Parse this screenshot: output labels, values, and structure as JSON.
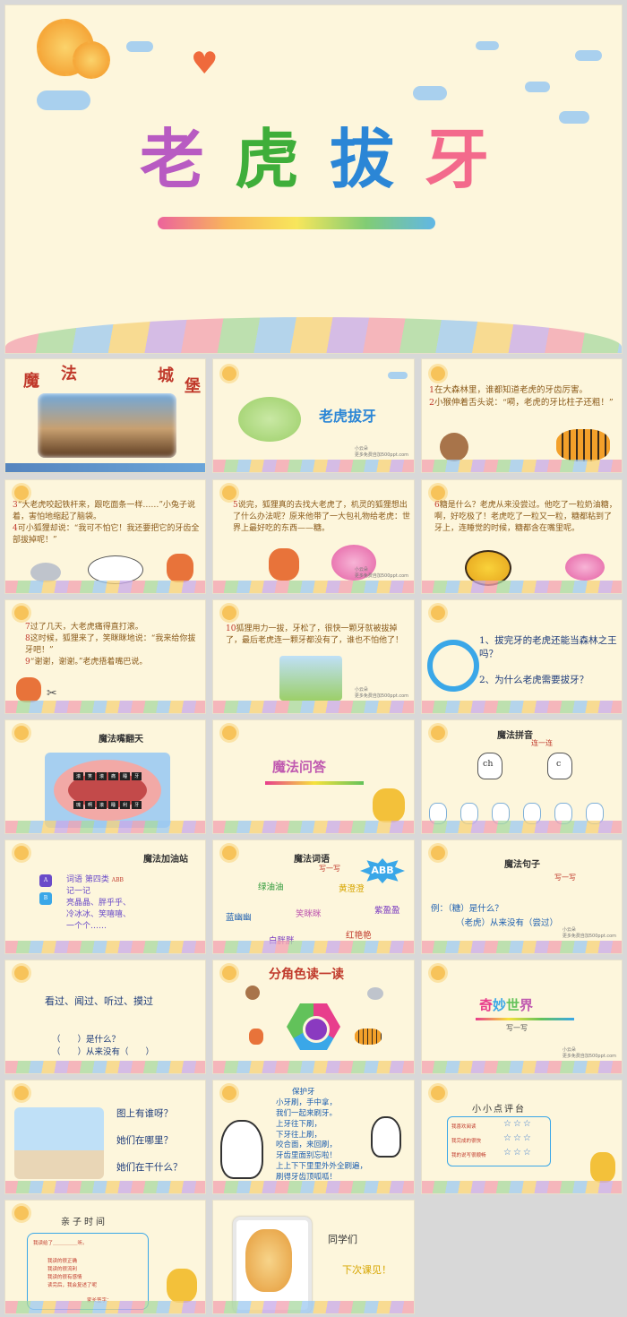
{
  "cover": {
    "c1": "老",
    "c2": "虎",
    "c3": "拔",
    "c4": "牙"
  },
  "s1": {
    "w1": "魔",
    "w2": "法",
    "w3": "城",
    "w4": "堡"
  },
  "s2": {
    "title": "老虎拔牙",
    "foot1": "小云朵",
    "foot2": "更多免费自加500ppt.com"
  },
  "s3": {
    "n1": "1",
    "p1": "在大森林里，谁都知道老虎的牙齿厉害。",
    "n2": "2",
    "p2": "小猴伸着舌头说：“嗬，老虎的牙比柱子还粗！”"
  },
  "s4": {
    "n1": "3",
    "p1": "“大老虎咬起铁杆来，跟吃面条一样……”小兔子说着，害怕地缩起了脑袋。",
    "n2": "4",
    "p2": "可小狐狸却说：“我可不怕它！我还要把它的牙齿全部拔掉呢！”"
  },
  "s5": {
    "n1": "5",
    "p1": "说完，狐狸真的去找大老虎了，机灵的狐狸想出了什么办法呢？原来他带了一大包礼物给老虎：世界上最好吃的东西——糖。",
    "foot1": "小云朵",
    "foot2": "更多免费自加500ppt.com"
  },
  "s6": {
    "n1": "6",
    "p1": "糖是什么？老虎从来没尝过。他吃了一粒奶油糖，啊，好吃极了！老虎吃了一粒又一粒，糖都粘到了牙上，连睡觉的时候，糖都含在嘴里呢。"
  },
  "s7": {
    "n1": "7",
    "p1": "过了几天，大老虎痛得直打滚。",
    "n2": "8",
    "p2": "这时候，狐狸来了，笑眯眯地说：“我来给你拔牙吧！”",
    "n3": "9",
    "p3": "“谢谢，谢谢。”老虎捂着嘴巴说。"
  },
  "s8": {
    "n1": "10",
    "p1": "狐狸用力一拔，牙松了，很快一颗牙就被拔掉了，最后老虎连一颗牙都没有了，谁也不怕他了！",
    "foot1": "小云朵",
    "foot2": "更多免费自加500ppt.com"
  },
  "s9": {
    "q1": "1、拔完牙的老虎还能当森林之王吗？",
    "q2": "2、为什么老虎需要拔牙？"
  },
  "s10": {
    "title": "魔法嘴翻天",
    "w1": "滚",
    "w2": "笑",
    "w3": "滚",
    "w4": "痛",
    "w5": "睡",
    "w6": "牙",
    "w7": "瑰",
    "w8": "啊",
    "w9": "滚",
    "w10": "睡",
    "w11": "利",
    "w12": "牙"
  },
  "s11": {
    "title": "魔法问答"
  },
  "s12": {
    "title": "魔法拼音",
    "sub": "连一连",
    "l1": "ch",
    "l2": "c"
  },
  "s13": {
    "title": "魔法加油站",
    "a": "A",
    "b": "B",
    "l1": "词语 第四类",
    "abb": "ABB",
    "l2": "记一记",
    "l3": "亮晶晶、胖乎乎、",
    "l4": "冷冰冰、笑嘻嘻、",
    "l5": "一个个……"
  },
  "s14": {
    "title": "魔法词语",
    "sub": "写一写",
    "abb": "ABB",
    "w1": "绿油油",
    "w2": "黄澄澄",
    "w3": "蓝幽幽",
    "w4": "笑眯眯",
    "w5": "紫盈盈",
    "w6": "白胖胖",
    "w7": "红艳艳"
  },
  "s15": {
    "title": "魔法句子",
    "sub": "写一写",
    "l1": "例：（糖）是什么？",
    "l2": "（老虎）从来没有（尝过）",
    "foot1": "小云朵",
    "foot2": "更多免费自加500ppt.com"
  },
  "s16": {
    "l1": "看过、闻过、听过、摸过",
    "l2": "（　　）是什么？",
    "l3": "（　　）从来没有（　　）"
  },
  "s17": {
    "title": "分角色读一读"
  },
  "s18": {
    "title": "奇妙世界",
    "sub": "写一写",
    "foot1": "小云朵",
    "foot2": "更多免费自加500ppt.com"
  },
  "s19": {
    "q1": "图上有谁呀？",
    "q2": "她们在哪里？",
    "q3": "她们在干什么？"
  },
  "s20": {
    "title": "保护牙",
    "l1": "小牙刷，手中拿，",
    "l2": "我们一起来刷牙。",
    "l3": "上牙往下刷，",
    "l4": "下牙往上刷，",
    "l5": "咬合面，来回刷，",
    "l6": "牙齿里面别忘啦！",
    "l7": "上上下下里里外外全刷遍，",
    "l8": "刷得牙齿顶呱呱！"
  },
  "s21": {
    "title": "小小点评台",
    "r1": "我喜欢阅读",
    "r2": "我完成的很快",
    "r3": "我的说写很顺畅",
    "stars": "☆☆☆"
  },
  "s22": {
    "title": "亲子时间",
    "l1": "我读给了＿＿＿＿＿听。",
    "l2": "我读的很正确",
    "l3": "我读的很流利",
    "l4": "我读的很有感情",
    "l5": "读完后，我会复述了呢",
    "l6": "家长签字："
  },
  "s23": {
    "l1": "同学们",
    "l2": "下次课见！"
  }
}
